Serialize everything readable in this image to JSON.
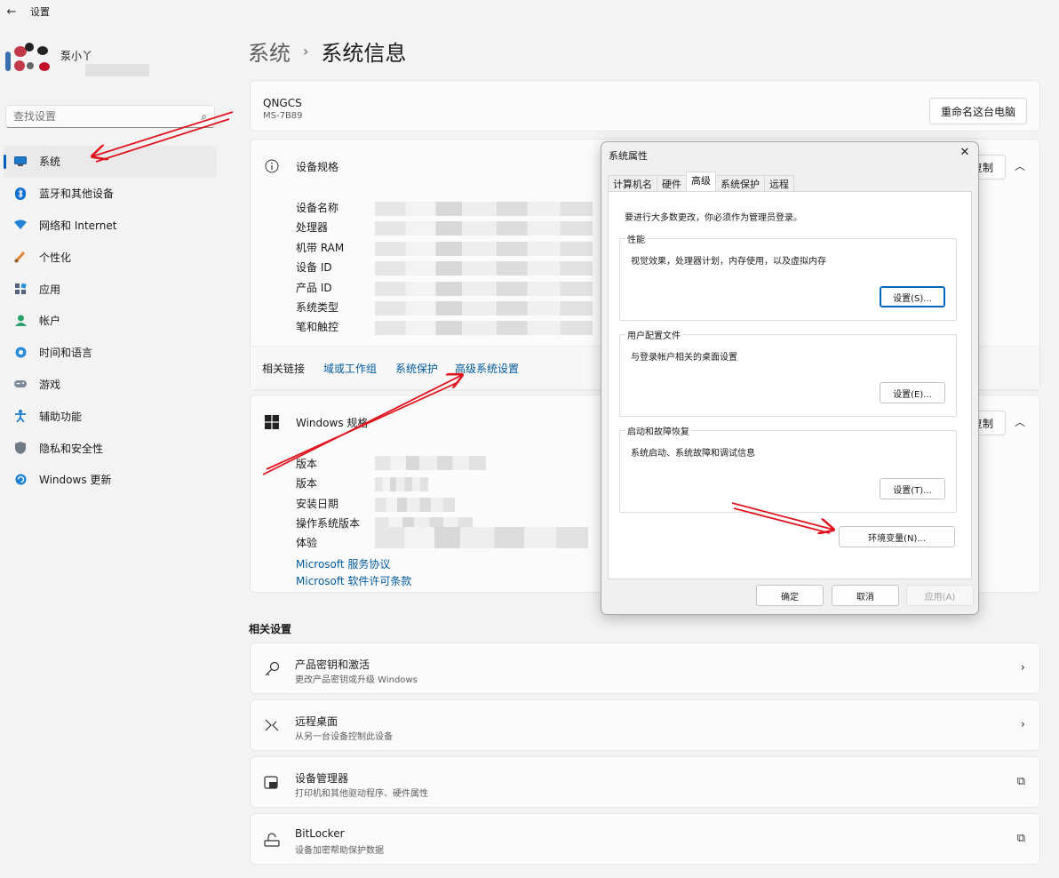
{
  "window": {
    "back_icon": "arrow-left-icon",
    "title": "设置"
  },
  "profile": {
    "name": "泵小丫"
  },
  "search": {
    "placeholder": "查找设置",
    "icon": "search-icon"
  },
  "sidebar": {
    "items": [
      {
        "label": "系统",
        "icon": "display-icon",
        "active": true
      },
      {
        "label": "蓝牙和其他设备",
        "icon": "bluetooth-icon"
      },
      {
        "label": "网络和 Internet",
        "icon": "wifi-icon"
      },
      {
        "label": "个性化",
        "icon": "brush-icon"
      },
      {
        "label": "应用",
        "icon": "apps-icon"
      },
      {
        "label": "帐户",
        "icon": "person-icon"
      },
      {
        "label": "时间和语言",
        "icon": "globe-clock-icon"
      },
      {
        "label": "游戏",
        "icon": "gamepad-icon"
      },
      {
        "label": "辅助功能",
        "icon": "accessibility-icon"
      },
      {
        "label": "隐私和安全性",
        "icon": "shield-icon"
      },
      {
        "label": "Windows 更新",
        "icon": "update-icon"
      }
    ]
  },
  "breadcrumb": {
    "parent": "系统",
    "separator": "›",
    "current": "系统信息"
  },
  "pc": {
    "name": "QNGCS",
    "model": "MS-7B89",
    "rename_label": "重命名这台电脑"
  },
  "device_spec": {
    "title": "设备规格",
    "copy_label": "复制",
    "rows": [
      "设备名称",
      "处理器",
      "机带 RAM",
      "设备 ID",
      "产品 ID",
      "系统类型",
      "笔和触控"
    ]
  },
  "related_links": {
    "label": "相关链接",
    "links": [
      "域或工作组",
      "系统保护",
      "高级系统设置"
    ]
  },
  "windows_spec": {
    "title": "Windows 规格",
    "copy_label": "复制",
    "rows": [
      "版本",
      "版本",
      "安装日期",
      "操作系统版本",
      "体验"
    ],
    "links": [
      "Microsoft 服务协议",
      "Microsoft 软件许可条款"
    ]
  },
  "related_settings": {
    "title": "相关设置",
    "items": [
      {
        "title": "产品密钥和激活",
        "subtitle": "更改产品密钥或升级 Windows",
        "icon": "key-icon",
        "tail": "chevron-right-icon"
      },
      {
        "title": "远程桌面",
        "subtitle": "从另一台设备控制此设备",
        "icon": "remote-desktop-icon",
        "tail": "chevron-right-icon"
      },
      {
        "title": "设备管理器",
        "subtitle": "打印机和其他驱动程序、硬件属性",
        "icon": "device-manager-icon",
        "tail": "external-link-icon"
      },
      {
        "title": "BitLocker",
        "subtitle": "设备加密帮助保护数据",
        "icon": "bitlocker-icon",
        "tail": "external-link-icon"
      }
    ]
  },
  "dialog": {
    "title": "系统属性",
    "tabs": [
      "计算机名",
      "硬件",
      "高级",
      "系统保护",
      "远程"
    ],
    "active_tab": "高级",
    "notice": "要进行大多数更改，你必须作为管理员登录。",
    "performance": {
      "legend": "性能",
      "desc": "视觉效果，处理器计划，内存使用，以及虚拟内存",
      "button": "设置(S)..."
    },
    "profiles": {
      "legend": "用户配置文件",
      "desc": "与登录帐户相关的桌面设置",
      "button": "设置(E)..."
    },
    "startup": {
      "legend": "启动和故障恢复",
      "desc": "系统启动、系统故障和调试信息",
      "button": "设置(T)..."
    },
    "env_button": "环境变量(N)...",
    "ok": "确定",
    "cancel": "取消",
    "apply": "应用(A)"
  },
  "colors": {
    "accent": "#005fb8",
    "link": "#005a9e",
    "annotation_arrow": "#e0141e"
  }
}
